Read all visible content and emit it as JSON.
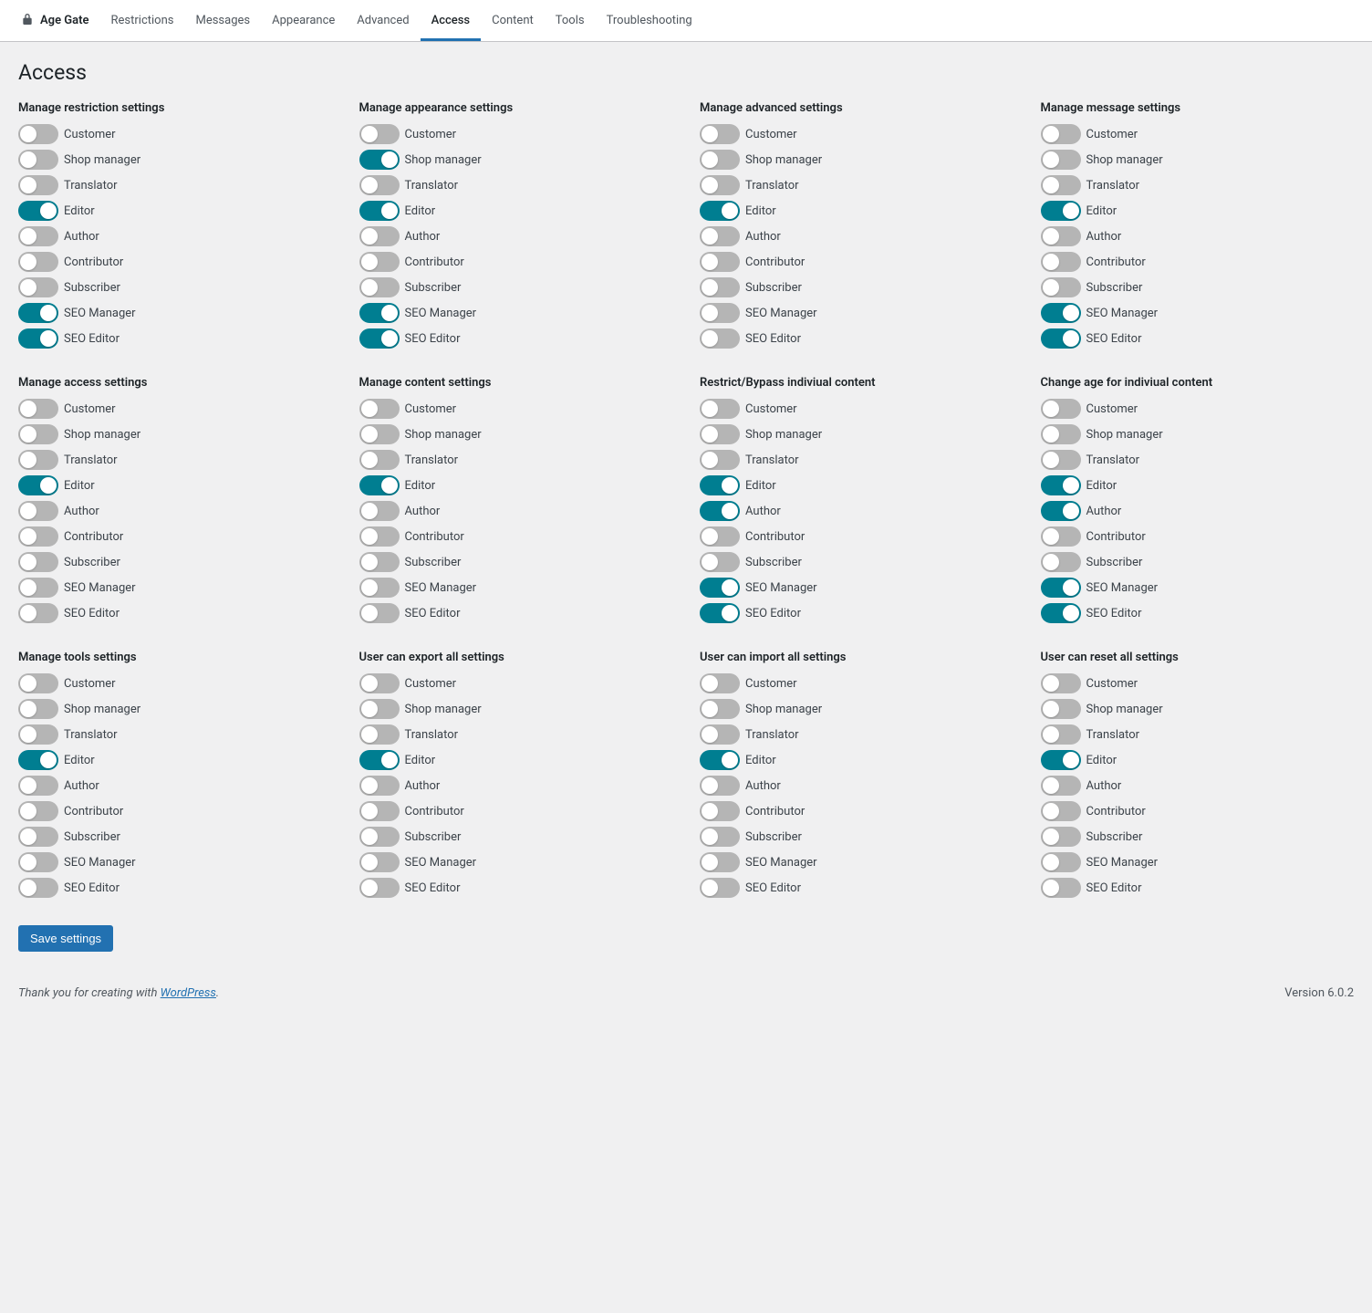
{
  "brand": "Age Gate",
  "tabs": [
    {
      "label": "Restrictions",
      "active": false
    },
    {
      "label": "Messages",
      "active": false
    },
    {
      "label": "Appearance",
      "active": false
    },
    {
      "label": "Advanced",
      "active": false
    },
    {
      "label": "Access",
      "active": true
    },
    {
      "label": "Content",
      "active": false
    },
    {
      "label": "Tools",
      "active": false
    },
    {
      "label": "Troubleshooting",
      "active": false
    }
  ],
  "page_title": "Access",
  "roles": [
    "Customer",
    "Shop manager",
    "Translator",
    "Editor",
    "Author",
    "Contributor",
    "Subscriber",
    "SEO Manager",
    "SEO Editor"
  ],
  "sections": [
    {
      "title": "Manage restriction settings",
      "toggles": [
        false,
        false,
        false,
        true,
        false,
        false,
        false,
        true,
        true
      ]
    },
    {
      "title": "Manage appearance settings",
      "toggles": [
        false,
        true,
        false,
        true,
        false,
        false,
        false,
        true,
        true
      ]
    },
    {
      "title": "Manage advanced settings",
      "toggles": [
        false,
        false,
        false,
        true,
        false,
        false,
        false,
        false,
        false
      ]
    },
    {
      "title": "Manage message settings",
      "toggles": [
        false,
        false,
        false,
        true,
        false,
        false,
        false,
        true,
        true
      ]
    },
    {
      "title": "Manage access settings",
      "toggles": [
        false,
        false,
        false,
        true,
        false,
        false,
        false,
        false,
        false
      ]
    },
    {
      "title": "Manage content settings",
      "toggles": [
        false,
        false,
        false,
        true,
        false,
        false,
        false,
        false,
        false
      ]
    },
    {
      "title": "Restrict/Bypass indiviual content",
      "toggles": [
        false,
        false,
        false,
        true,
        true,
        false,
        false,
        true,
        true
      ]
    },
    {
      "title": "Change age for indiviual content",
      "toggles": [
        false,
        false,
        false,
        true,
        true,
        false,
        false,
        true,
        true
      ]
    },
    {
      "title": "Manage tools settings",
      "toggles": [
        false,
        false,
        false,
        true,
        false,
        false,
        false,
        false,
        false
      ]
    },
    {
      "title": "User can export all settings",
      "toggles": [
        false,
        false,
        false,
        true,
        false,
        false,
        false,
        false,
        false
      ]
    },
    {
      "title": "User can import all settings",
      "toggles": [
        false,
        false,
        false,
        true,
        false,
        false,
        false,
        false,
        false
      ]
    },
    {
      "title": "User can reset all settings",
      "toggles": [
        false,
        false,
        false,
        true,
        false,
        false,
        false,
        false,
        false
      ]
    }
  ],
  "save_label": "Save settings",
  "footer_prefix": "Thank you for creating with ",
  "footer_link": "WordPress",
  "footer_suffix": ".",
  "version": "Version 6.0.2"
}
